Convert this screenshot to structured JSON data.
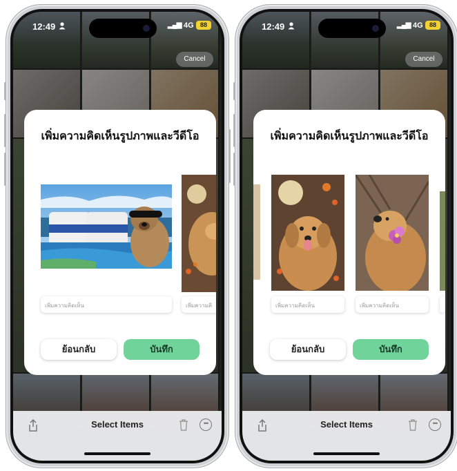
{
  "left_phone": {
    "status": {
      "time": "12:49",
      "network": "4G",
      "battery": "88"
    },
    "cancel_label": "Cancel",
    "dialog": {
      "title": "เพิ่มความคิดเห็นรูปภาพและวีดีโอ",
      "comment_placeholder_main": "เพิ่มความคิดเห็น",
      "comment_placeholder_peek": "เพิ่มความคิ",
      "back_label": "ย้อนกลับ",
      "save_label": "บันทึก"
    },
    "bottom_bar": {
      "title": "Select Items"
    }
  },
  "right_phone": {
    "status": {
      "time": "12:49",
      "network": "4G",
      "battery": "88"
    },
    "cancel_label": "Cancel",
    "dialog": {
      "title": "เพิ่มความคิดเห็นรูปภาพและวีดีโอ",
      "comment_placeholder_1": "เพิ่มความคิดเห็น",
      "comment_placeholder_2": "เพิ่มความคิดเห็น",
      "back_label": "ย้อนกลับ",
      "save_label": "บันทึก"
    },
    "bottom_bar": {
      "title": "Select Items"
    }
  },
  "icons": {
    "person": "person-icon",
    "share": "share-icon",
    "trash": "trash-icon",
    "more": "more-icon"
  },
  "colors": {
    "save_button": "#6fd39a",
    "battery": "#f2d230",
    "dialog_bg": "#ffffff"
  }
}
